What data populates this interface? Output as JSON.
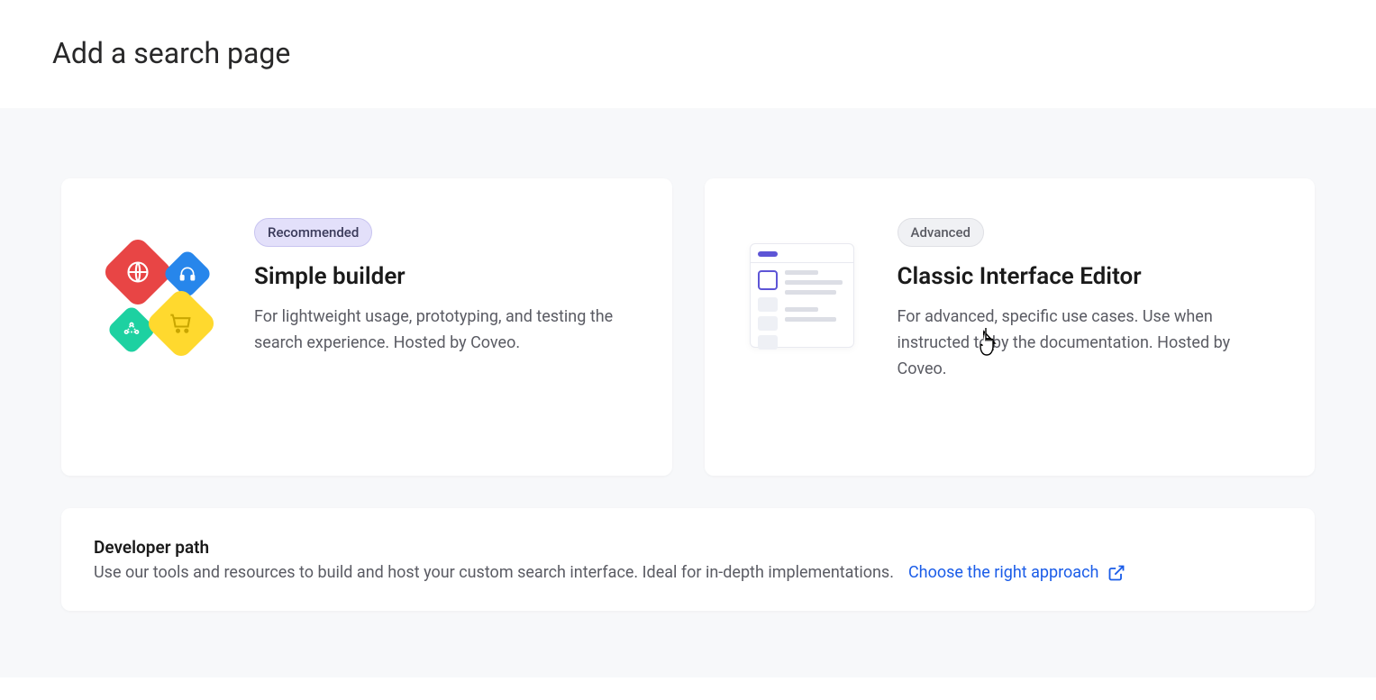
{
  "header": {
    "title": "Add a search page"
  },
  "cards": {
    "simple": {
      "badge": "Recommended",
      "title": "Simple builder",
      "description": "For lightweight usage, prototyping, and testing the search experience. Hosted by Coveo."
    },
    "classic": {
      "badge": "Advanced",
      "title": "Classic Interface Editor",
      "description": "For advanced, specific use cases. Use when instructed to by the documentation. Hosted by Coveo."
    }
  },
  "developer": {
    "title": "Developer path",
    "text": "Use our tools and resources to build and host your custom search interface. Ideal for in-depth implementations.",
    "link": "Choose the right approach"
  }
}
